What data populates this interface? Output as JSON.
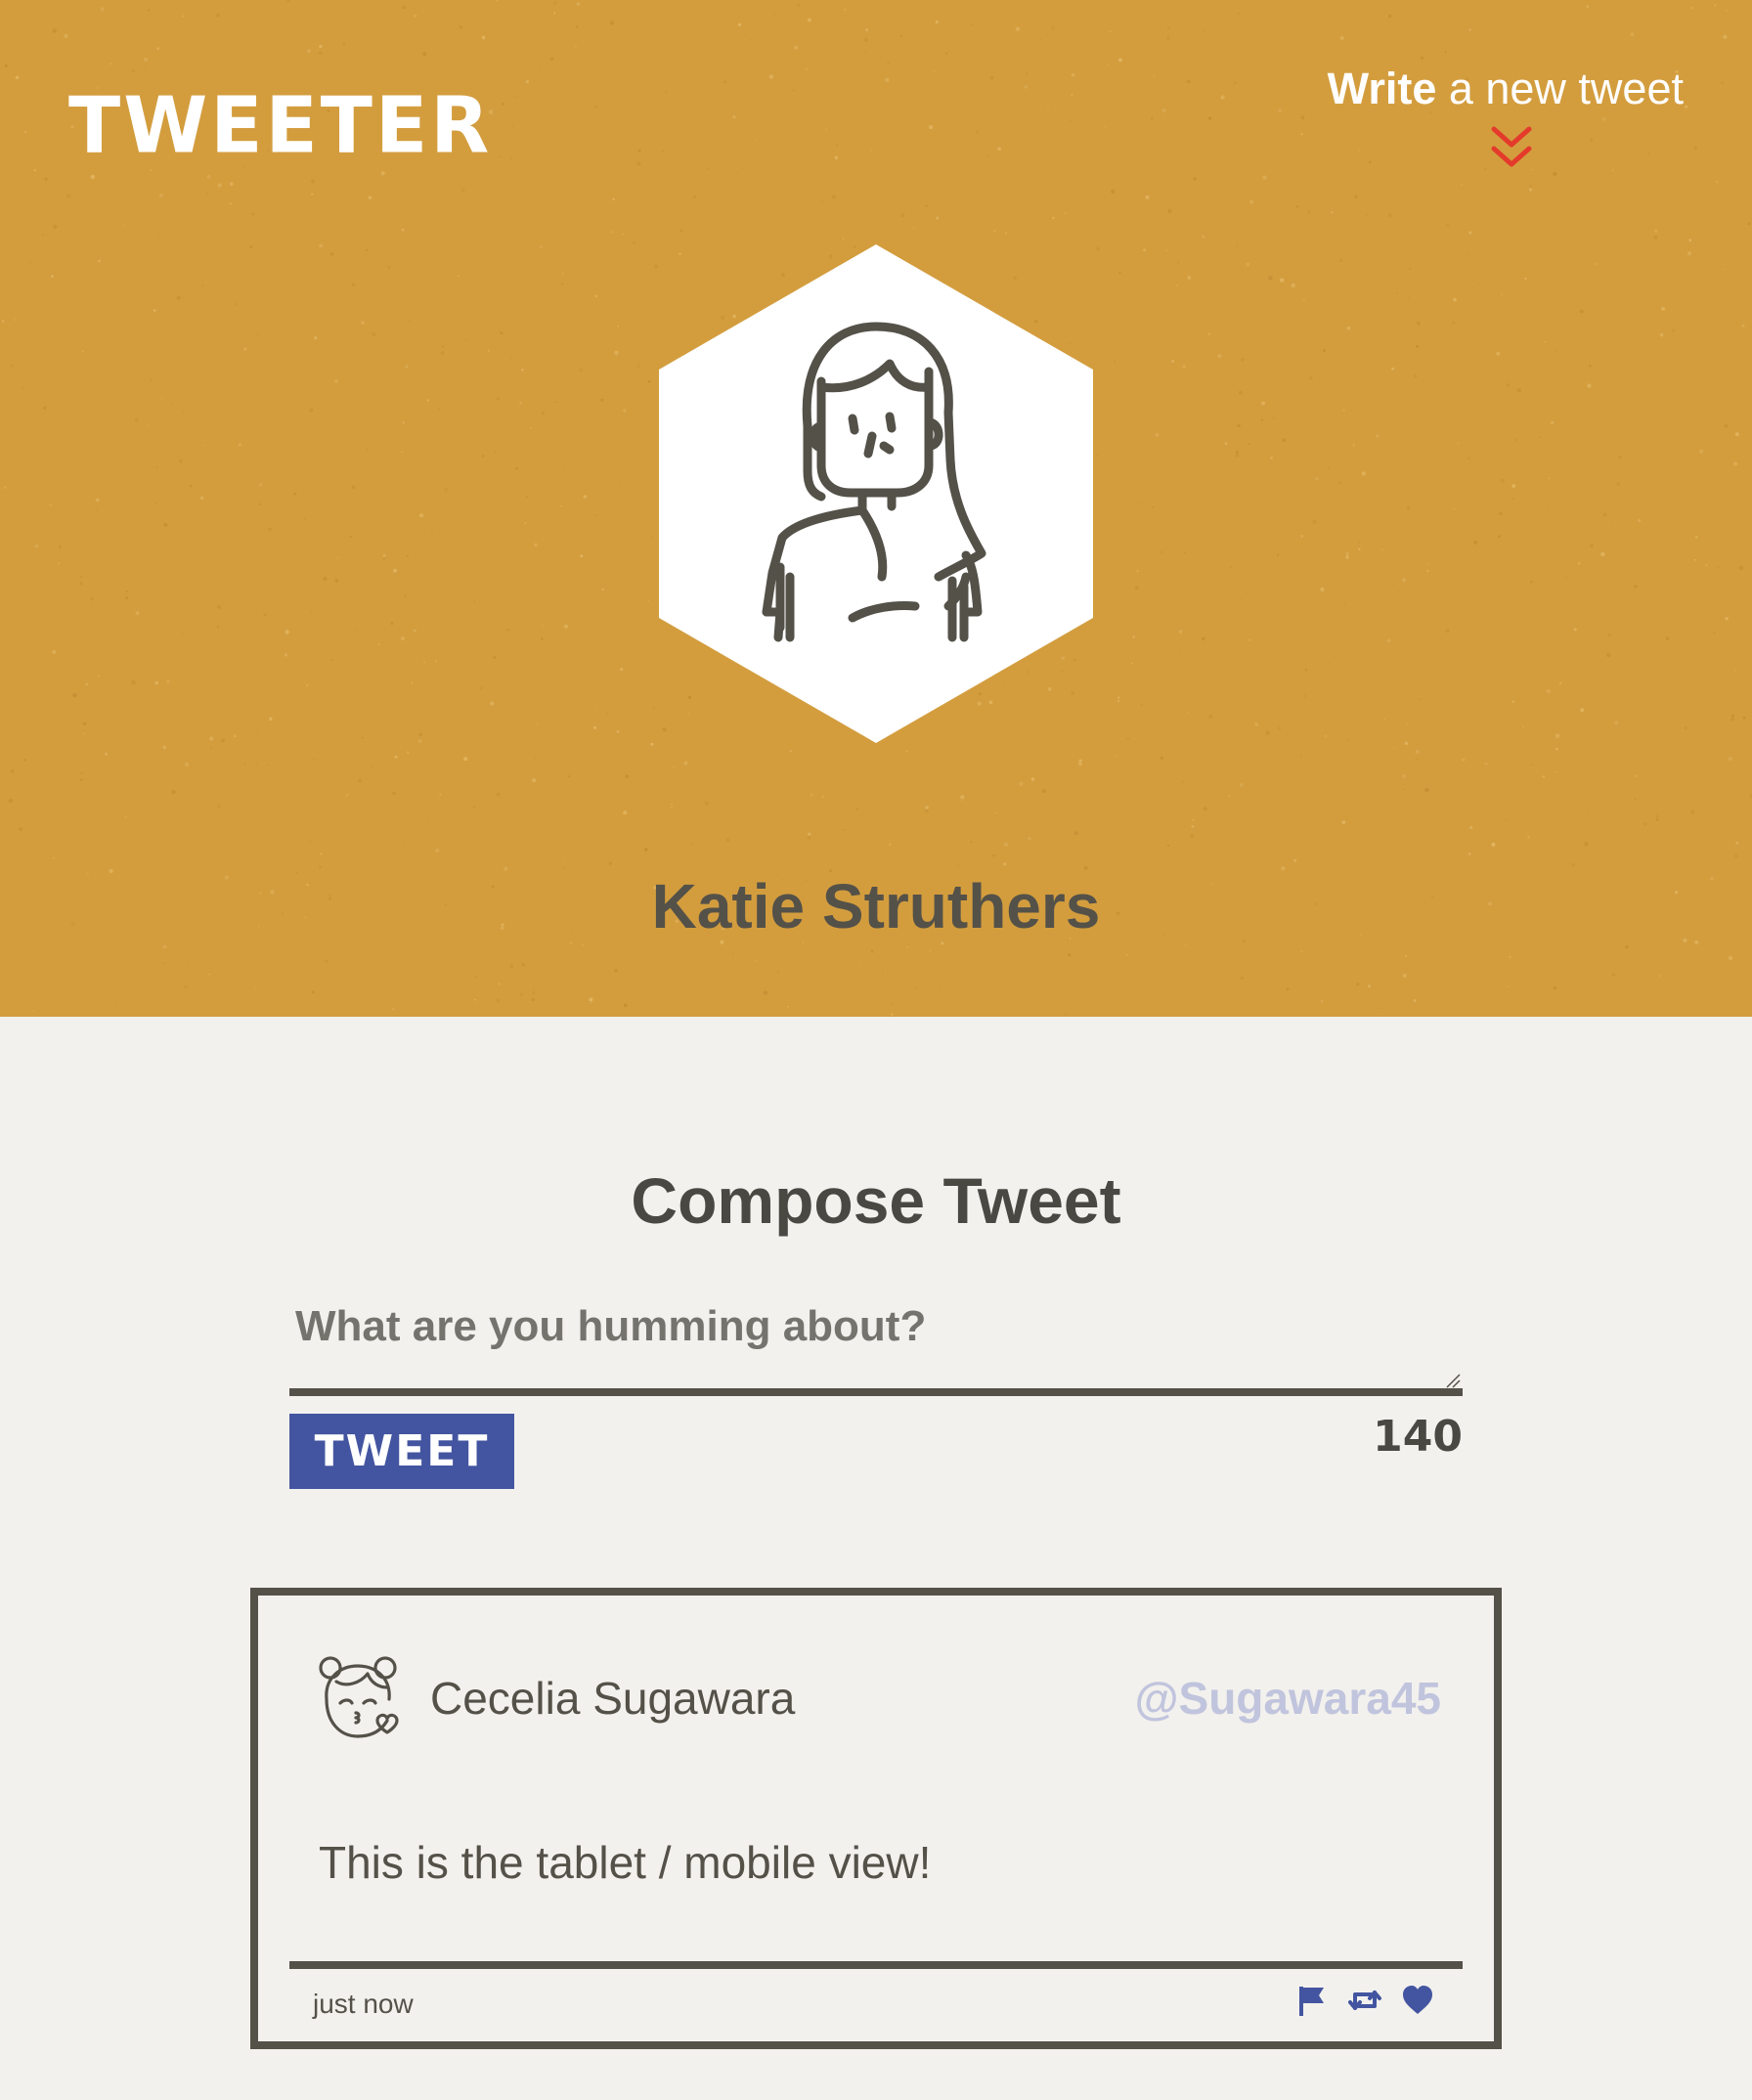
{
  "nav": {
    "logo": "TWEETER",
    "write_link_strong": "Write",
    "write_link_rest": " a new tweet",
    "chevron_icon": "double-chevron-down-icon",
    "chevron_color": "#e43a2b"
  },
  "profile": {
    "name": "Katie Struthers",
    "avatar_icon": "woman-avatar-icon",
    "background_color": "#d39d3e"
  },
  "compose": {
    "title": "Compose Tweet",
    "placeholder": "What are you humming about?",
    "value": "",
    "tweet_button_label": "TWEET",
    "char_count": "140",
    "button_color": "#4355a0"
  },
  "tweets": [
    {
      "author": "Cecelia Sugawara",
      "handle": "@Sugawara45",
      "body": "This is the tablet / mobile view!",
      "time": "just now",
      "avatar_icon": "girl-kiss-avatar-icon",
      "actions": [
        "flag-icon",
        "retweet-icon",
        "heart-icon"
      ],
      "action_color": "#4355a0"
    }
  ]
}
